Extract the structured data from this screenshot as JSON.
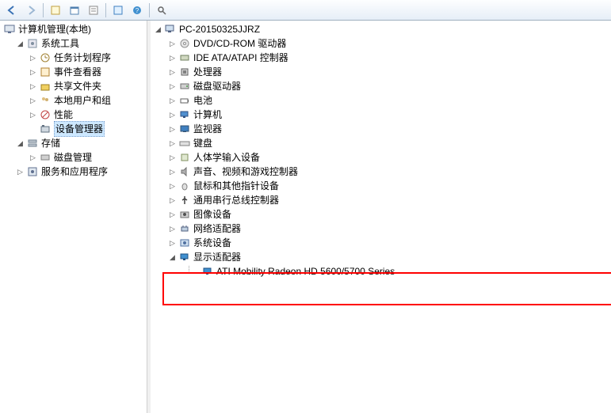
{
  "toolbar": {
    "icons": [
      "back-icon",
      "forward-icon",
      "sep",
      "note-icon",
      "calendar-icon",
      "doc-icon",
      "sep",
      "refresh-icon",
      "help-icon",
      "sep",
      "search-icon"
    ]
  },
  "left_tree": {
    "root_label": "计算机管理(本地)",
    "groups": [
      {
        "label": "系统工具",
        "expanded": true,
        "children": [
          {
            "label": "任务计划程序",
            "icon": "clock"
          },
          {
            "label": "事件查看器",
            "icon": "event"
          },
          {
            "label": "共享文件夹",
            "icon": "share"
          },
          {
            "label": "本地用户和组",
            "icon": "users"
          },
          {
            "label": "性能",
            "icon": "perf"
          },
          {
            "label": "设备管理器",
            "icon": "device"
          }
        ]
      },
      {
        "label": "存储",
        "expanded": true,
        "children": [
          {
            "label": "磁盘管理",
            "icon": "disk"
          }
        ]
      },
      {
        "label": "服务和应用程序",
        "expanded": false,
        "children": []
      }
    ]
  },
  "right_tree": {
    "root_label": "PC-20150325JJRZ",
    "categories": [
      {
        "label": "DVD/CD-ROM 驱动器",
        "icon": "cd"
      },
      {
        "label": "IDE ATA/ATAPI 控制器",
        "icon": "ide"
      },
      {
        "label": "处理器",
        "icon": "cpu"
      },
      {
        "label": "磁盘驱动器",
        "icon": "hdd"
      },
      {
        "label": "电池",
        "icon": "battery"
      },
      {
        "label": "计算机",
        "icon": "computer"
      },
      {
        "label": "监视器",
        "icon": "monitor"
      },
      {
        "label": "键盘",
        "icon": "keyboard"
      },
      {
        "label": "人体学输入设备",
        "icon": "hid"
      },
      {
        "label": "声音、视频和游戏控制器",
        "icon": "sound"
      },
      {
        "label": "鼠标和其他指针设备",
        "icon": "mouse"
      },
      {
        "label": "通用串行总线控制器",
        "icon": "usb"
      },
      {
        "label": "图像设备",
        "icon": "camera"
      },
      {
        "label": "网络适配器",
        "icon": "network"
      },
      {
        "label": "系统设备",
        "icon": "system"
      },
      {
        "label": "显示适配器",
        "icon": "display",
        "expanded": true,
        "children": [
          {
            "label": "ATI Mobility Radeon HD 5600/5700 Series",
            "icon": "display"
          }
        ]
      }
    ]
  }
}
